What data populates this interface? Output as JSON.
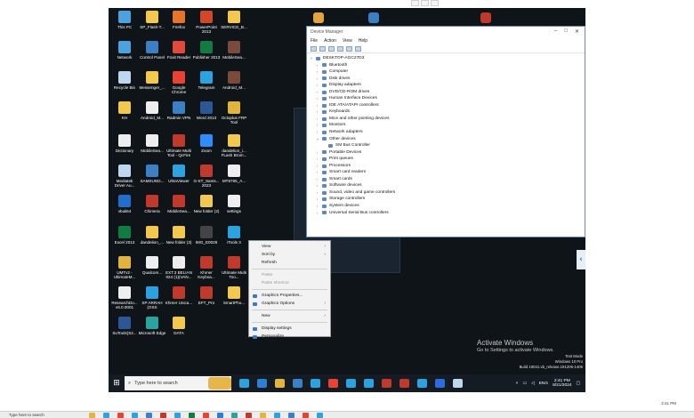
{
  "desktop_icons": [
    {
      "label": "This PC",
      "color": "#4aa3df"
    },
    {
      "label": "SP_Flash-T...",
      "color": "#f2c94c"
    },
    {
      "label": "Firefox",
      "color": "#e8732a"
    },
    {
      "label": "PowerPoint 2013",
      "color": "#d24726"
    },
    {
      "label": "SERVICE_B...",
      "color": "#f2c94c"
    },
    {
      "label": "Network",
      "color": "#4aa3df"
    },
    {
      "label": "Control Panel",
      "color": "#3b7fc4"
    },
    {
      "label": "Foxit Reader",
      "color": "#e04a3c"
    },
    {
      "label": "Publisher 2013",
      "color": "#107c41"
    },
    {
      "label": "MobileSea...",
      "color": "#7a4b3a"
    },
    {
      "label": "Recycle Bin",
      "color": "#bcd7ee"
    },
    {
      "label": "Messenger_...",
      "color": "#f2c94c"
    },
    {
      "label": "Google Chrome",
      "color": "#e94235"
    },
    {
      "label": "Telegram",
      "color": "#2aa3e0"
    },
    {
      "label": "Android_M...",
      "color": "#7a4b3a"
    },
    {
      "label": "KH",
      "color": "#f2c94c"
    },
    {
      "label": "Android_M...",
      "color": "#eeeeee"
    },
    {
      "label": "Radmin VPN",
      "color": "#3b7fc4"
    },
    {
      "label": "Word 2013",
      "color": "#2b5797"
    },
    {
      "label": "Octoplus FRP Tool",
      "color": "#e2b43b"
    },
    {
      "label": "Dictionary",
      "color": "#eeeeee"
    },
    {
      "label": "MobileSea...",
      "color": "#eeeeee"
    },
    {
      "label": "Ultimate Multi Tool - QcFire",
      "color": "#c0392b"
    },
    {
      "label": "Zoom",
      "color": "#2d8cff"
    },
    {
      "label": "dandelion_i... FLash Brom...",
      "color": "#f2c94c"
    },
    {
      "label": "Mediatek Driver Au...",
      "color": "#bcd7ee"
    },
    {
      "label": "SAMSUNG...",
      "color": "#3b7fc4"
    },
    {
      "label": "UltraViewer",
      "color": "#2aa3e0"
    },
    {
      "label": "G-ST_Sams... 2023",
      "color": "#c0392b"
    },
    {
      "label": "MT6765_A...",
      "color": "#eeeeee"
    },
    {
      "label": "vbuli64",
      "color": "#1f6fd1"
    },
    {
      "label": "Chimera",
      "color": "#c0392b"
    },
    {
      "label": "MobileSea...",
      "color": "#c0392b"
    },
    {
      "label": "New folder (2)",
      "color": "#f2c94c"
    },
    {
      "label": "settings",
      "color": "#eeeeee"
    },
    {
      "label": "Excel 2013",
      "color": "#107c41"
    },
    {
      "label": "dandelion_...",
      "color": "#f2c94c"
    },
    {
      "label": "New folder (3)",
      "color": "#f2c94c"
    },
    {
      "label": "IMG_E0028",
      "color": "#444444"
    },
    {
      "label": "iTools 3",
      "color": "#2aa3e0"
    },
    {
      "label": "UMTv2 - UltimateM...",
      "color": "#e2b43b"
    },
    {
      "label": "Qualcom...",
      "color": "#eeeeee"
    },
    {
      "label": "EXT.3 BELIAN 024 (1)(VAN...",
      "color": "#eeeeee"
    },
    {
      "label": "Khmer Keyboa...",
      "color": "#c0392b"
    },
    {
      "label": "Ultimate Multi Too...",
      "color": "#c0392b"
    },
    {
      "label": "ResearchDo... v6.0.0001",
      "color": "#eeeeee"
    },
    {
      "label": "SP ARRAH (OSS",
      "color": "#2aa3e0"
    },
    {
      "label": "Khmer Unica...",
      "color": "#c0392b"
    },
    {
      "label": "EFT_Pro",
      "color": "#c0392b"
    },
    {
      "label": "SmartPho...",
      "color": "#f2c94c"
    },
    {
      "label": "SuTools(S2...",
      "color": "#2b5797"
    },
    {
      "label": "Microsoft Edge",
      "color": "#2aa3a0"
    },
    {
      "label": "DATA",
      "color": "#f2c94c"
    }
  ],
  "device_manager": {
    "title": "Device Manager",
    "window_controls": [
      "–",
      "□",
      "✕"
    ],
    "menu": [
      "File",
      "Action",
      "View",
      "Help"
    ],
    "tree": [
      {
        "label": "DESKTOP-AGC27D3",
        "level": 0,
        "expanded": true
      },
      {
        "label": "Bluetooth",
        "level": 1
      },
      {
        "label": "Computer",
        "level": 1
      },
      {
        "label": "Disk drives",
        "level": 1
      },
      {
        "label": "Display adapters",
        "level": 1
      },
      {
        "label": "DVD/CD-ROM drives",
        "level": 1
      },
      {
        "label": "Human Interface Devices",
        "level": 1
      },
      {
        "label": "IDE ATA/ATAPI controllers",
        "level": 1
      },
      {
        "label": "Keyboards",
        "level": 1
      },
      {
        "label": "Mice and other pointing devices",
        "level": 1
      },
      {
        "label": "Monitors",
        "level": 1
      },
      {
        "label": "Network adapters",
        "level": 1
      },
      {
        "label": "Other devices",
        "level": 1,
        "expanded": true
      },
      {
        "label": "SM Bus Controller",
        "level": 2
      },
      {
        "label": "Portable Devices",
        "level": 1
      },
      {
        "label": "Print queues",
        "level": 1
      },
      {
        "label": "Processors",
        "level": 1
      },
      {
        "label": "Smart card readers",
        "level": 1
      },
      {
        "label": "Smart cards",
        "level": 1
      },
      {
        "label": "Software devices",
        "level": 1
      },
      {
        "label": "Sound, video and game controllers",
        "level": 1
      },
      {
        "label": "Storage controllers",
        "level": 1
      },
      {
        "label": "System devices",
        "level": 1
      },
      {
        "label": "Universal Serial Bus controllers",
        "level": 1
      }
    ]
  },
  "context_menu": [
    {
      "label": "View",
      "submenu": true
    },
    {
      "label": "Sort by",
      "submenu": true
    },
    {
      "label": "Refresh"
    },
    {
      "separator": true
    },
    {
      "label": "Paste",
      "disabled": true
    },
    {
      "label": "Paste shortcut",
      "disabled": true
    },
    {
      "separator": true
    },
    {
      "label": "Graphics Properties...",
      "icon": true
    },
    {
      "label": "Graphics Options",
      "icon": true,
      "submenu": true
    },
    {
      "separator": true
    },
    {
      "label": "New",
      "submenu": true
    },
    {
      "separator": true
    },
    {
      "label": "Display settings",
      "icon": true
    },
    {
      "label": "Personalize",
      "icon": true
    }
  ],
  "watermark": {
    "title": "Activate Windows",
    "subtitle": "Go to Settings to activate Windows."
  },
  "build_info": {
    "line1": "Test Mode",
    "line2": "Windows 10 Pro",
    "line3": "Build 19041.vb_release.191206-1406"
  },
  "taskbar": {
    "search_placeholder": "Type here to search",
    "tray_lang": "ENG",
    "time": "2:41 PM",
    "date": "8/21/2024",
    "app_colors": [
      "#2aa3e0",
      "#2b7fd4",
      "#e2b43b",
      "#3b7fc4",
      "#2aa3e0",
      "#e94235",
      "#2aa3e0",
      "#2aa3e0",
      "#c0392b",
      "#c0392b",
      "#2aa3e0",
      "#2d6cdf",
      "#bcd7ee"
    ]
  },
  "host_taskbar": {
    "search_placeholder": "Type here to search",
    "time": "2:41 PM",
    "icon_colors": [
      "#e2b43b",
      "#2aa3e0",
      "#e94235",
      "#2aa3e0",
      "#3b7fc4",
      "#c0392b",
      "#2aa3e0",
      "#107c41",
      "#e94235",
      "#2b7fd4",
      "#2aa3a0",
      "#c0392b",
      "#e2b43b",
      "#2aa3e0",
      "#3b7fc4",
      "#e94235",
      "#2aa3e0"
    ]
  },
  "top_apps_colors": [
    "#e2a53b",
    "#3b7fc4",
    "#c0392b"
  ]
}
